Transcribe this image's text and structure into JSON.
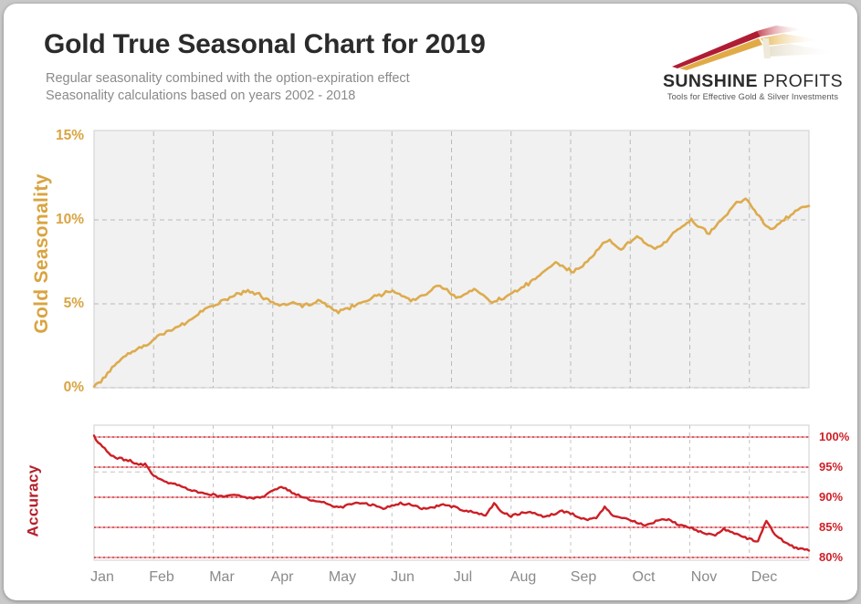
{
  "header": {
    "title": "Gold True Seasonal Chart for 2019",
    "subtitle_1": "Regular seasonality combined with the option-expiration effect",
    "subtitle_2": "Seasonality calculations based on years 2002 - 2018"
  },
  "logo": {
    "name_bold": "SUNSHINE",
    "name_light": "PROFITS",
    "tagline": "Tools for Effective Gold & Silver Investments",
    "mark": "sunburst-rays-logo",
    "colors": {
      "crimson": "#b01c33",
      "gold": "#e5b14a",
      "cream": "#efe6cf"
    }
  },
  "axes": {
    "left_label": "Gold Seasonality",
    "left_ticks": [
      "15%",
      "10%",
      "5%",
      "0%"
    ],
    "right_label": "Accuracy",
    "right_ticks": [
      "100%",
      "95%",
      "90%",
      "85%",
      "80%"
    ],
    "x_ticks": [
      "Jan",
      "Feb",
      "Mar",
      "Apr",
      "May",
      "Jun",
      "Jul",
      "Aug",
      "Sep",
      "Oct",
      "Nov",
      "Dec"
    ]
  },
  "colors": {
    "gold_series": "#ddab4d",
    "accuracy_series": "#cc1f26",
    "plot_background": "#f1f1f1",
    "grid": "#bdbdbd",
    "accuracy_gridline": "#e8949a",
    "title": "#2b2b2b",
    "subtitle": "#8a8a8a"
  },
  "chart_data": {
    "type": "line",
    "title": "Gold True Seasonal Chart for 2019",
    "subtitle": "Regular seasonality combined with the option-expiration effect / Seasonality calculations based on years 2002 - 2018",
    "xlabel": "",
    "grid": true,
    "legend": "none",
    "panels": [
      {
        "name": "Gold Seasonality",
        "ylabel": "Gold Seasonality",
        "ylim": [
          0,
          15
        ],
        "yunit": "%",
        "yticks": [
          0,
          5,
          10,
          15
        ],
        "color": "#ddab4d",
        "x": [
          "Jan",
          "Feb",
          "Mar",
          "Apr",
          "May",
          "Jun",
          "Jul",
          "Aug",
          "Sep",
          "Oct",
          "Nov",
          "Dec"
        ],
        "values": [
          0.0,
          0.5,
          1.2,
          1.7,
          2.1,
          2.4,
          2.6,
          3.1,
          3.3,
          3.6,
          3.8,
          4.2,
          4.6,
          4.9,
          5.1,
          5.4,
          5.6,
          5.8,
          5.6,
          5.3,
          5.0,
          4.9,
          5.1,
          4.9,
          5.0,
          5.2,
          4.8,
          4.5,
          4.7,
          5.0,
          5.2,
          5.4,
          5.6,
          5.8,
          5.5,
          5.2,
          5.4,
          5.7,
          6.1,
          5.8,
          5.4,
          5.6,
          5.9,
          5.5,
          5.1,
          5.3,
          5.6,
          5.9,
          6.2,
          6.6,
          7.0,
          7.4,
          7.2,
          6.9,
          7.3,
          7.8,
          8.5,
          8.8,
          8.2,
          8.6,
          9.0,
          8.6,
          8.2,
          8.6,
          9.2,
          9.6,
          10.0,
          9.6,
          9.2,
          9.8,
          10.4,
          11.0,
          11.3,
          10.6,
          9.8,
          9.5,
          9.9,
          10.3,
          10.7,
          10.9
        ],
        "series_notes": "daily seasonality path rising from 0% in January to roughly 11% by mid-December, peaking near 11.3%"
      },
      {
        "name": "Accuracy",
        "ylabel": "Accuracy",
        "ylim": [
          78,
          103
        ],
        "yunit": "%",
        "yticks": [
          80,
          85,
          90,
          95,
          100
        ],
        "color": "#cc1f26",
        "x": [
          "Jan",
          "Feb",
          "Mar",
          "Apr",
          "May",
          "Jun",
          "Jul",
          "Aug",
          "Sep",
          "Oct",
          "Nov",
          "Dec"
        ],
        "values": [
          100.0,
          98.4,
          97.0,
          96.4,
          96.2,
          95.6,
          95.4,
          93.6,
          92.8,
          92.3,
          91.9,
          91.4,
          91.0,
          90.7,
          90.4,
          90.1,
          90.5,
          90.2,
          89.9,
          89.8,
          90.2,
          91.2,
          91.6,
          91.0,
          90.3,
          89.8,
          89.5,
          89.2,
          88.6,
          88.3,
          88.8,
          89.2,
          89.0,
          88.6,
          88.2,
          88.6,
          89.0,
          88.8,
          88.4,
          88.0,
          88.4,
          88.8,
          88.5,
          88.0,
          87.6,
          87.3,
          87.0,
          88.9,
          87.4,
          86.9,
          87.3,
          87.6,
          87.2,
          86.8,
          87.2,
          87.6,
          87.3,
          86.6,
          86.2,
          86.6,
          88.5,
          87.0,
          86.6,
          86.2,
          85.7,
          85.4,
          86.0,
          86.4,
          85.9,
          85.4,
          84.9,
          84.4,
          83.9,
          83.6,
          84.8,
          84.2,
          83.6,
          83.0,
          82.6,
          86.2,
          83.8,
          82.8,
          81.9,
          81.4,
          81.2
        ],
        "series_notes": "accuracy declining from 100% in January toward ~81% in December, with sharp upward spikes at option-expiration dates"
      }
    ]
  }
}
